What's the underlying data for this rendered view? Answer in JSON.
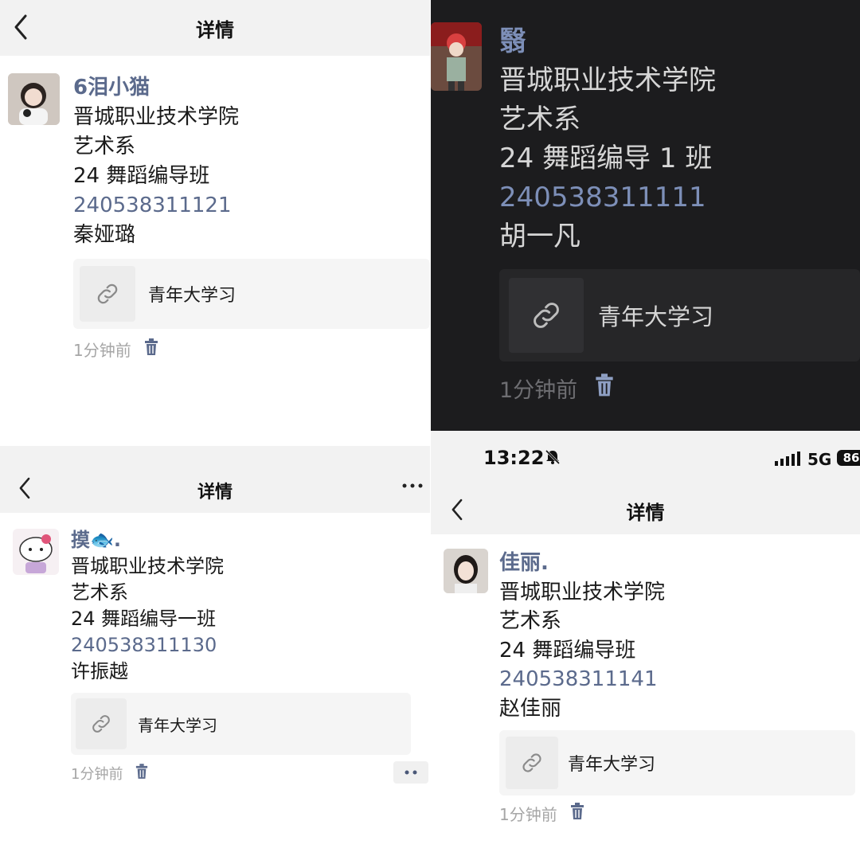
{
  "panels": [
    {
      "nav_title": "详情",
      "nickname": "6泪小猫",
      "lines": [
        "晋城职业技术学院",
        "艺术系",
        "24 舞蹈编导班"
      ],
      "student_id": "240538311121",
      "real_name": "秦娅璐",
      "link_title": "青年大学习",
      "time": "1分钟前"
    },
    {
      "nickname": "翳",
      "lines": [
        "晋城职业技术学院",
        "艺术系",
        "24 舞蹈编导 1 班"
      ],
      "student_id": "240538311111",
      "real_name": "胡一凡",
      "link_title": "青年大学习",
      "time": "1分钟前"
    },
    {
      "nav_title": "详情",
      "nickname": "摸🐟.",
      "lines": [
        "晋城职业技术学院",
        "艺术系",
        "24 舞蹈编导一班"
      ],
      "student_id": "240538311130",
      "real_name": "许振越",
      "link_title": "青年大学习",
      "time": "1分钟前"
    },
    {
      "status_time": "13:22",
      "network": "5G",
      "battery": "86",
      "nav_title": "详情",
      "nickname": "佳丽.",
      "lines": [
        "晋城职业技术学院",
        "艺术系",
        "24 舞蹈编导班"
      ],
      "student_id": "240538311141",
      "real_name": "赵佳丽",
      "link_title": "青年大学习",
      "time": "1分钟前"
    }
  ],
  "icons": {
    "back": "chevron-left-icon",
    "link": "link-icon",
    "trash": "trash-icon",
    "more": "more-dots-icon",
    "mute": "bell-off-icon",
    "signal": "signal-icon",
    "battery": "battery-icon"
  },
  "colors": {
    "name": "#5b6a8c",
    "number": "#5b6a8c",
    "dark_bg": "#1c1c1e",
    "nav_bg": "#f2f2f2"
  }
}
